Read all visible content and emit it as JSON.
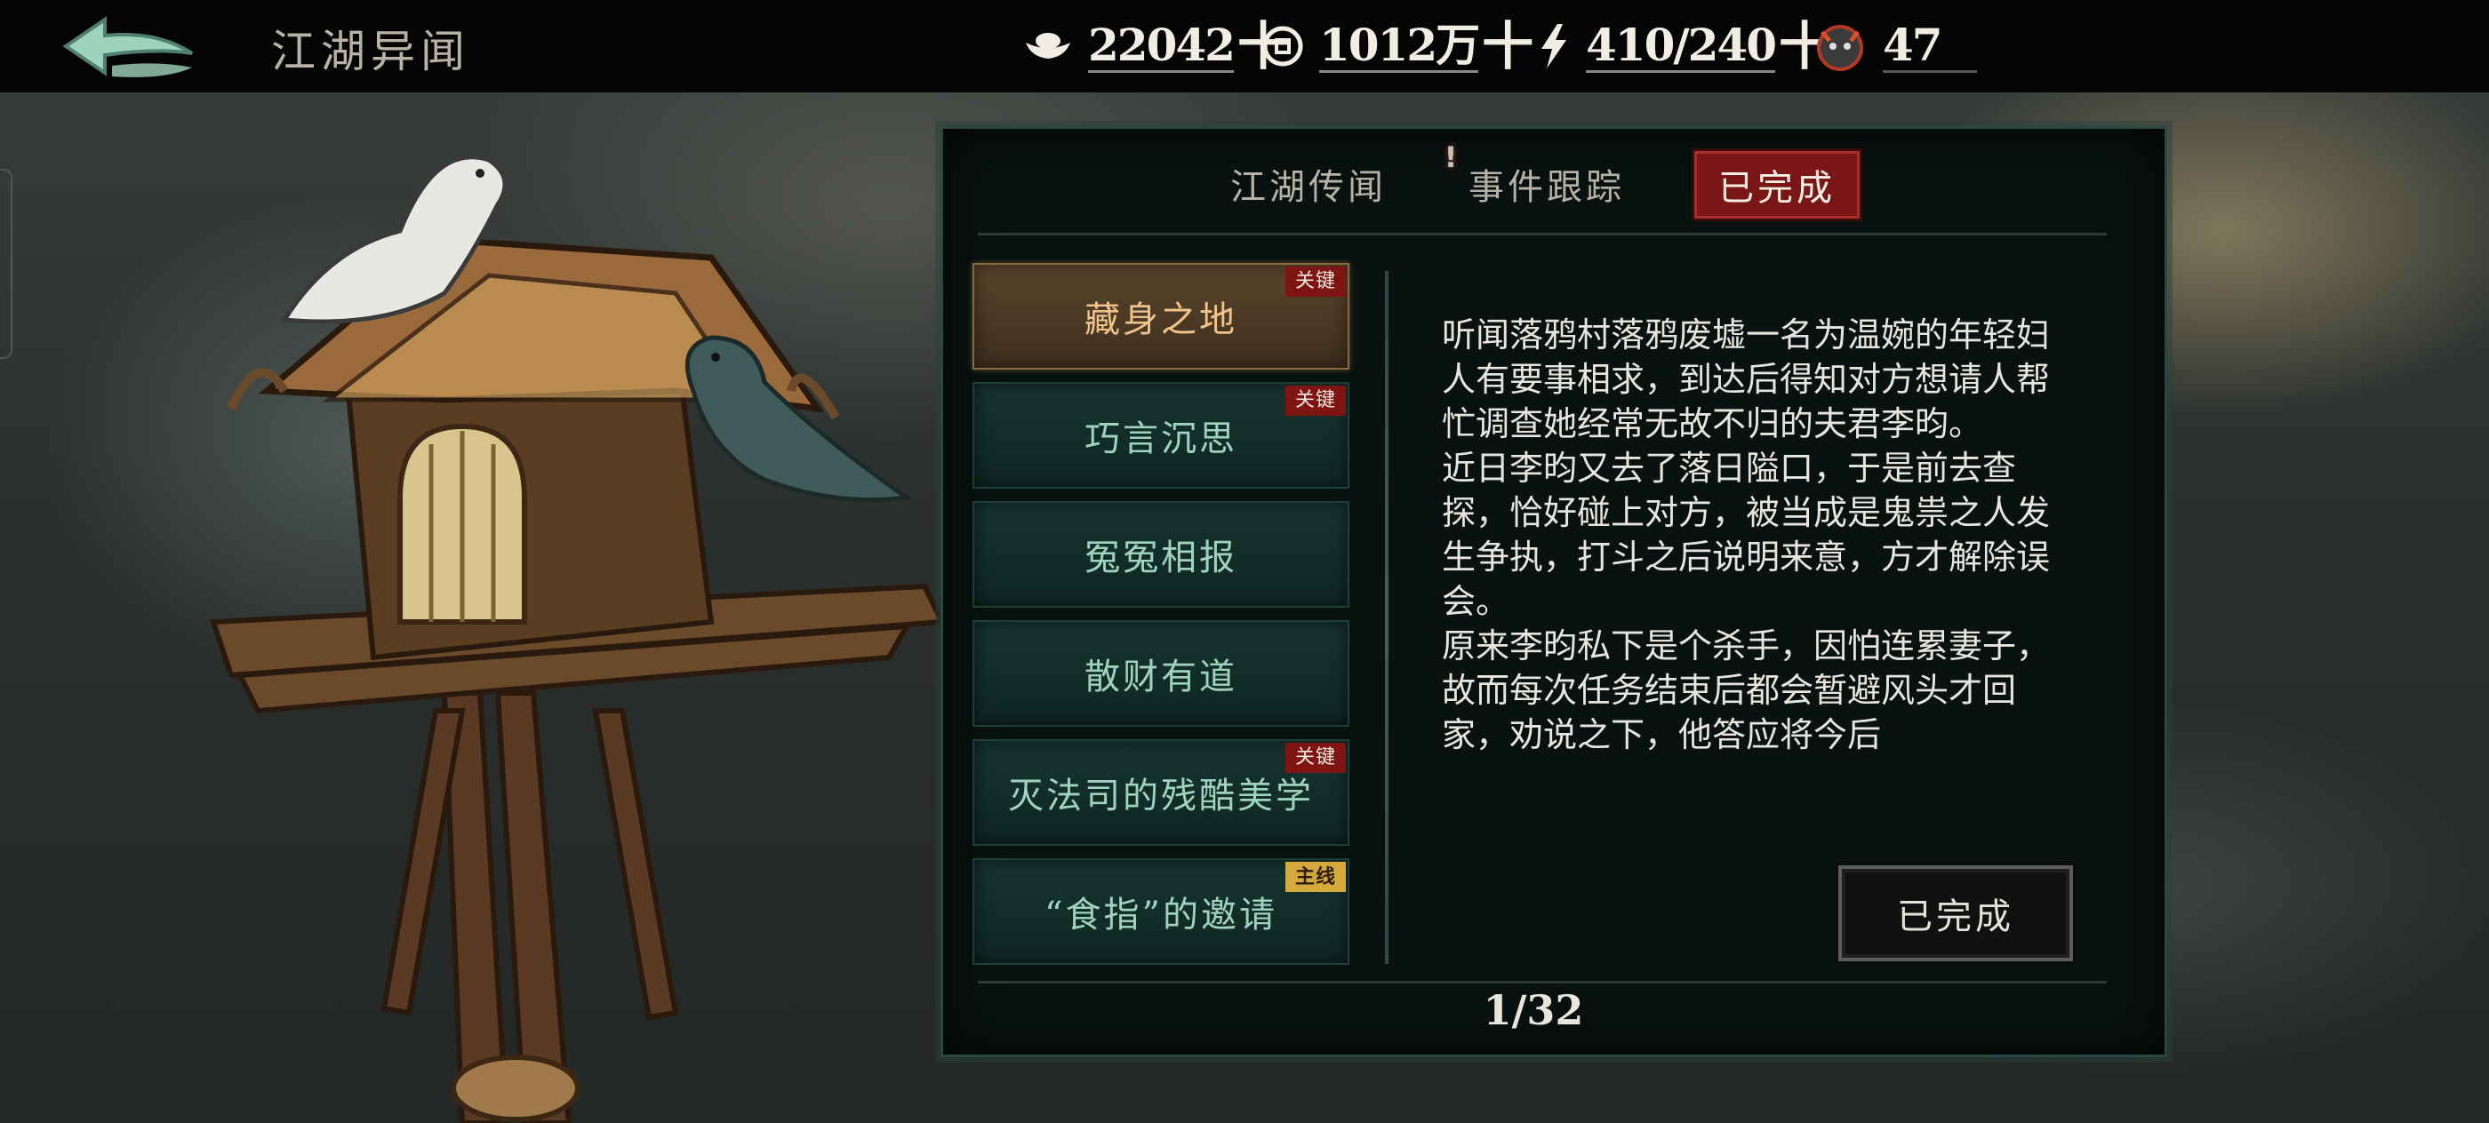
{
  "header": {
    "title": "江湖异闻",
    "resources": [
      {
        "icon": "silver-ingot-icon",
        "value": "22042",
        "suffix": "十"
      },
      {
        "icon": "copper-coin-icon",
        "value": "1012万",
        "suffix": "十"
      },
      {
        "icon": "lightning-icon",
        "value": "410/240",
        "suffix": "十"
      },
      {
        "icon": "demon-mask-icon",
        "value": "47",
        "suffix": ""
      }
    ]
  },
  "tabs": [
    {
      "label": "江湖传闻",
      "active": false
    },
    {
      "label": "事件跟踪",
      "active": false,
      "alert": "!"
    },
    {
      "label": "已完成",
      "active": true
    }
  ],
  "events": [
    {
      "label": "藏身之地",
      "tag": "关键",
      "tag_type": "key",
      "selected": true
    },
    {
      "label": "巧言沉思",
      "tag": "关键",
      "tag_type": "key",
      "selected": false
    },
    {
      "label": "冤冤相报",
      "tag": "",
      "tag_type": "",
      "selected": false
    },
    {
      "label": "散财有道",
      "tag": "",
      "tag_type": "",
      "selected": false
    },
    {
      "label": "灭法司的残酷美学",
      "tag": "关键",
      "tag_type": "key",
      "selected": false
    },
    {
      "label": "“食指”的邀请",
      "tag": "主线",
      "tag_type": "main",
      "selected": false
    }
  ],
  "description": [
    "听闻落鸦村落鸦废墟一名为温婉的年轻妇人有要事相求，到达后得知对方想请人帮忙调查她经常无故不归的夫君李昀。",
    "近日李昀又去了落日隘口，于是前去查探，恰好碰上对方，被当成是鬼祟之人发生争执，打斗之后说明来意，方才解除误会。",
    "原来李昀私下是个杀手，因怕连累妻子，故而每次任务结束后都会暂避风头才回家，劝说之下，他答应将今后"
  ],
  "status_button": "已完成",
  "pager": "1/32"
}
